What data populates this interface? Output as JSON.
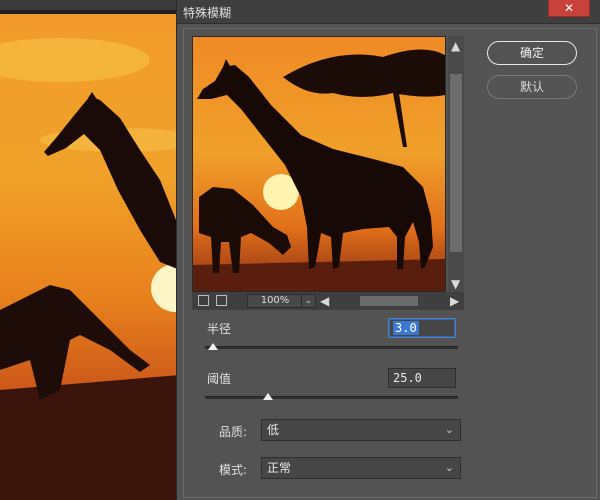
{
  "dialog": {
    "title": "特殊模糊",
    "close_icon": "close-icon",
    "close_glyph": "✕"
  },
  "preview": {
    "zoom_label": "100%",
    "zoom_dropdown_glyph": "⌄",
    "scroll_up_glyph": "▲",
    "scroll_down_glyph": "▼",
    "scroll_left_glyph": "◀",
    "scroll_right_glyph": "▶"
  },
  "buttons": {
    "ok_label": "确定",
    "default_label": "默认"
  },
  "params": {
    "radius_label": "半径",
    "radius_value": "3.0",
    "radius_slider_fraction": 0.03,
    "threshold_label": "阈值",
    "threshold_value": "25.0",
    "threshold_slider_fraction": 0.25,
    "quality_label": "品质:",
    "quality_value": "低",
    "mode_label": "模式:",
    "mode_value": "正常",
    "chevron_glyph": "⌄"
  },
  "colors": {
    "dialog_bg": "#535353",
    "close_red": "#c8413a",
    "selection_blue": "#3b78d0"
  }
}
